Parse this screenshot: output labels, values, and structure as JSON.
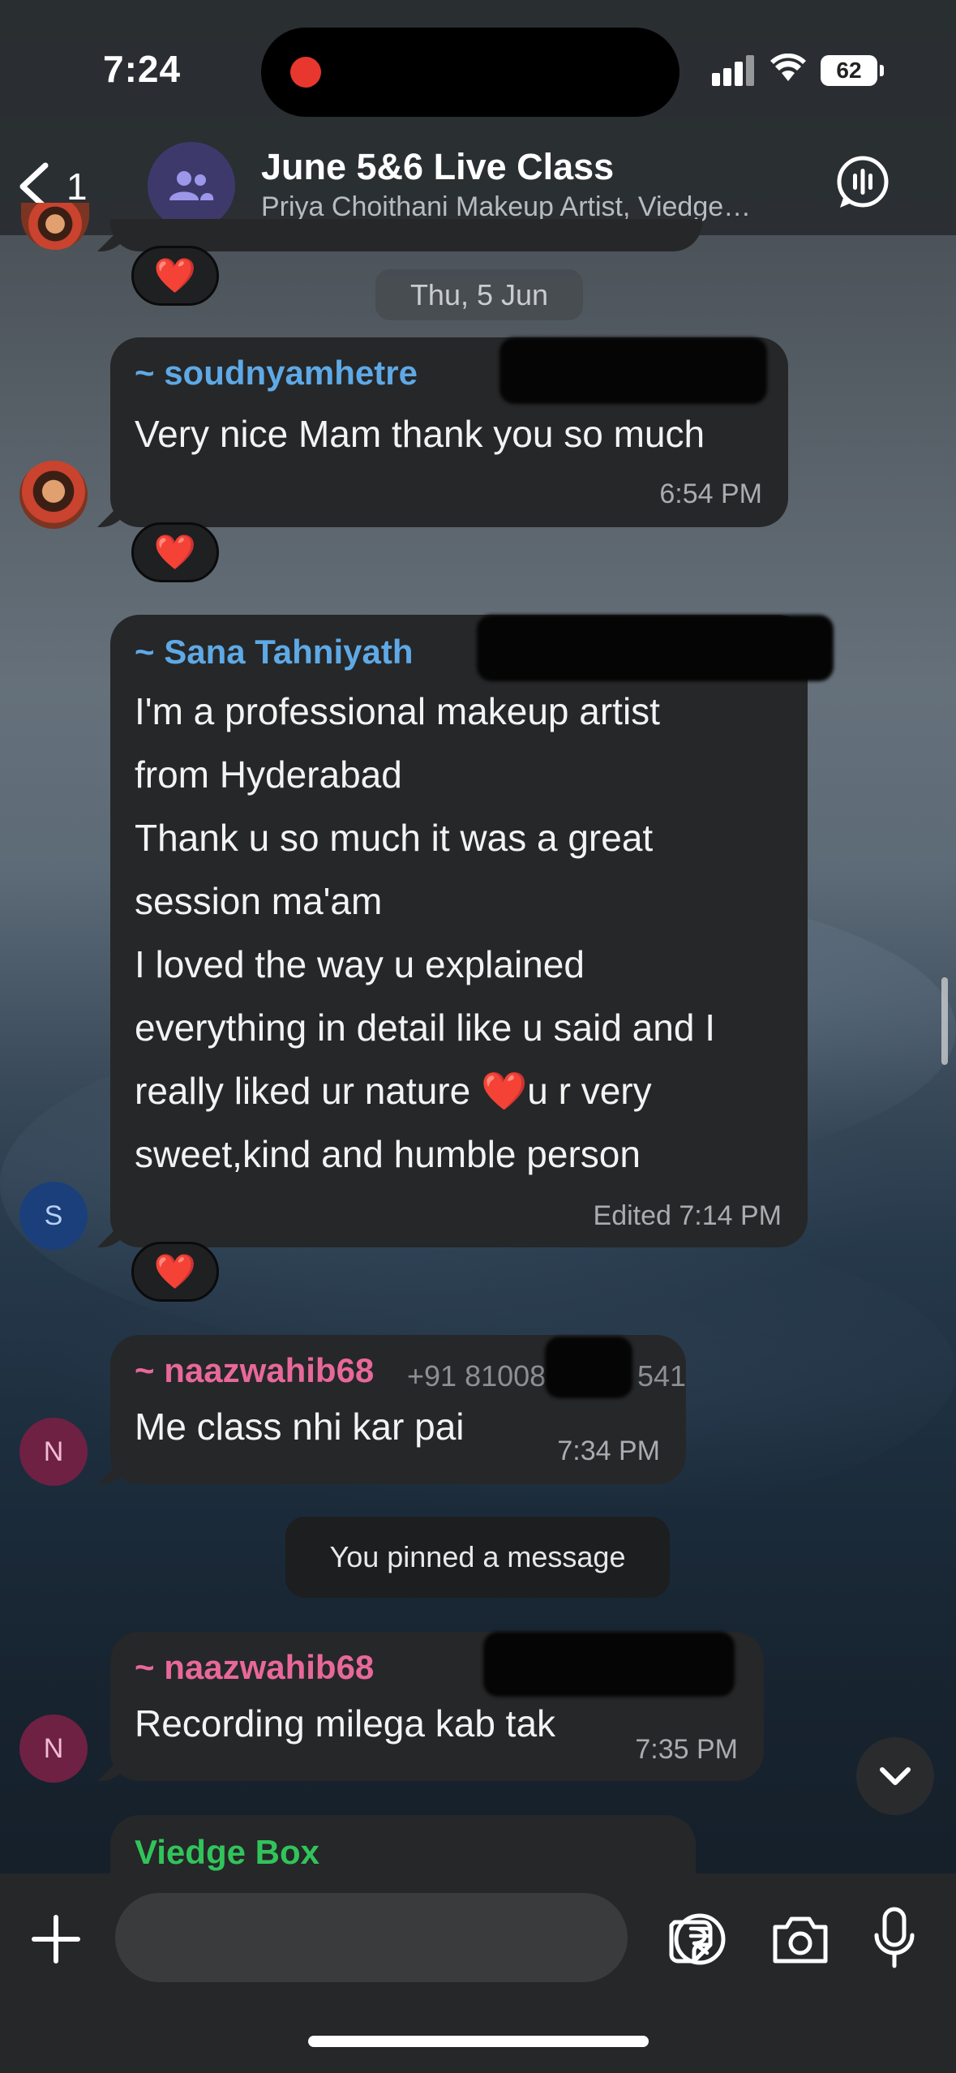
{
  "status_bar": {
    "time": "7:24",
    "battery": "62"
  },
  "header": {
    "back_count": "1",
    "title": "June 5&6 Live Class",
    "subtitle": "Priya Choithani Makeup Artist, Viedge…"
  },
  "chat": {
    "date_separator": "Thu, 5 Jun",
    "messages": [
      {
        "sender": "~ soudnyamhetre",
        "text": "Very nice Mam thank you so much",
        "time": "6:54 PM",
        "reaction": "❤️",
        "avatar": ""
      },
      {
        "sender": "~ Sana Tahniyath",
        "lines": [
          "I'm a professional makeup artist",
          "from Hyderabad",
          "Thank u so much it was a great",
          "session ma'am",
          "I loved the way u explained",
          "everything in detail like u said and I",
          "really liked ur nature ❤️u r very",
          "sweet,kind and humble person"
        ],
        "time": "Edited 7:14 PM",
        "reaction": "❤️",
        "avatar": "S"
      },
      {
        "sender": "~ naazwahib68",
        "phone": "+91 81008",
        "phone_tail": "541",
        "text": "Me class nhi kar pai",
        "time": "7:34 PM",
        "avatar": "N"
      },
      {
        "sender": "~ naazwahib68",
        "text": "Recording milega kab tak",
        "time": "7:35 PM",
        "avatar": "N"
      },
      {
        "sender": "Viedge Box"
      }
    ],
    "system_message": "You pinned a message",
    "top_reaction": "❤️"
  },
  "colors": {
    "sender_blue": "#5ea9e6",
    "sender_pink": "#e8689a",
    "sender_green": "#31c45b",
    "bubble": "#262728"
  }
}
